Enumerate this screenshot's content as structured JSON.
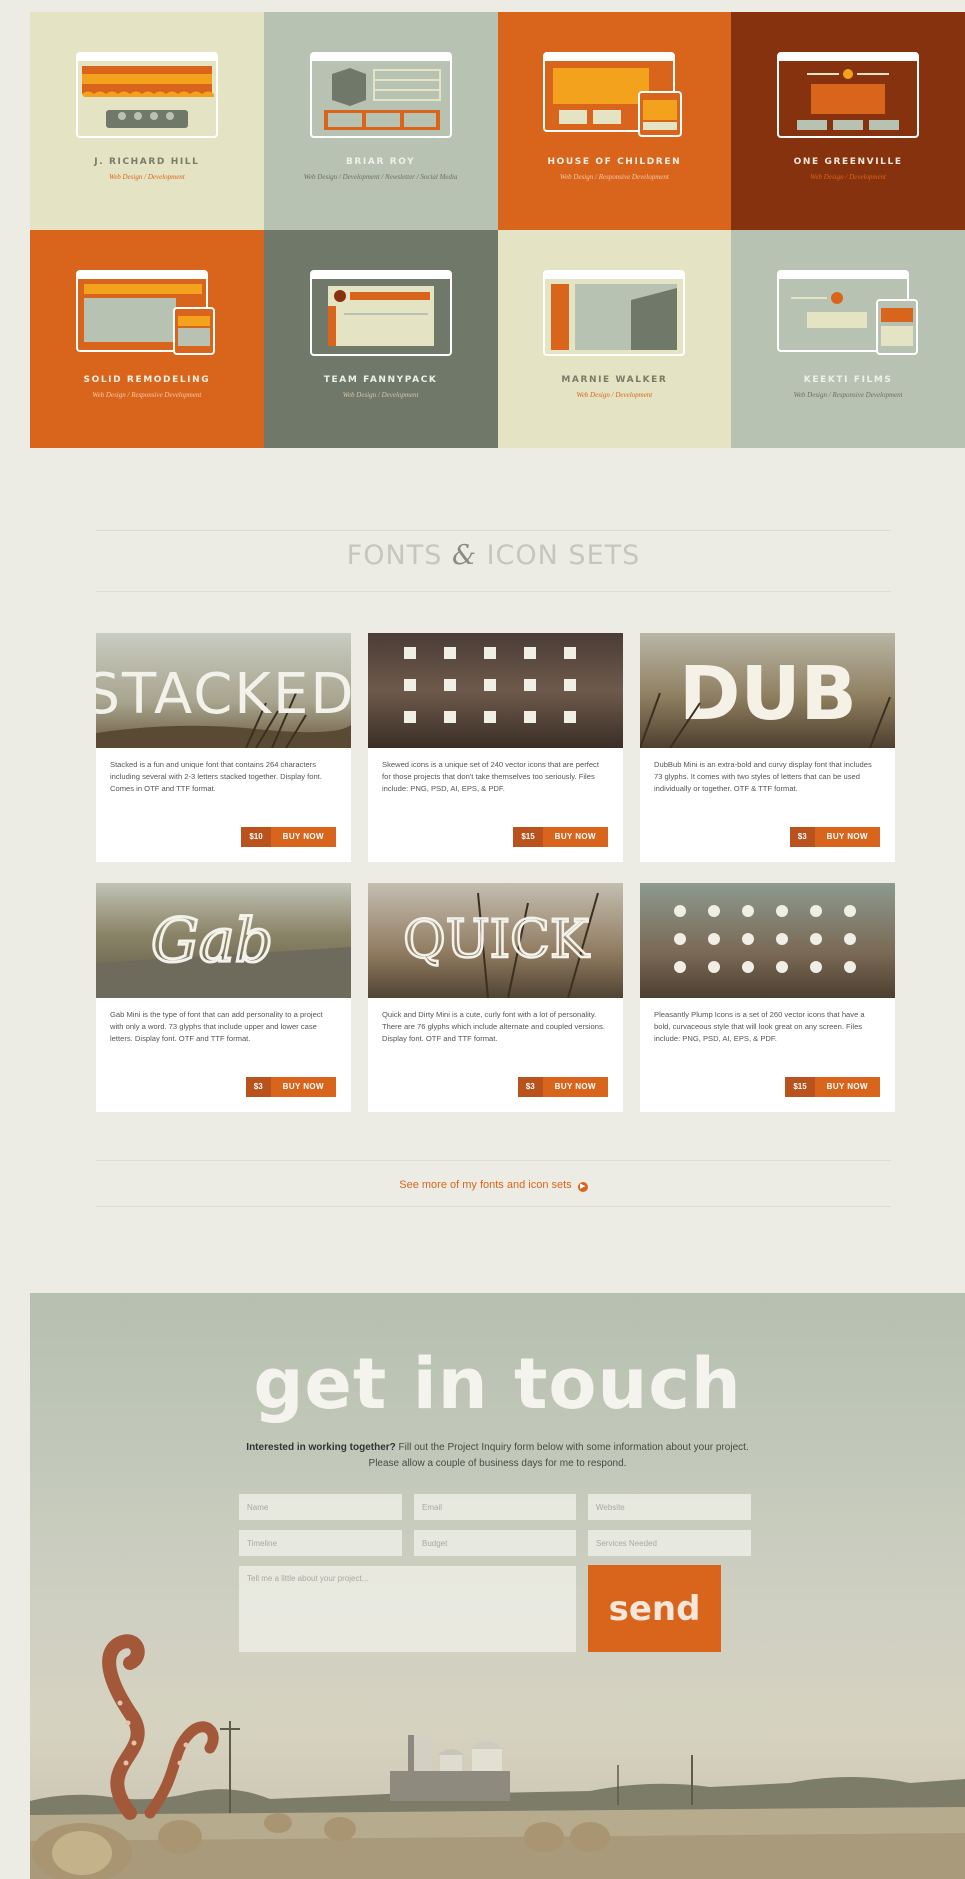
{
  "portfolio": [
    {
      "title": "J. RICHARD HILL",
      "sub": "Web Design / Development",
      "bg": "#e4e3c3",
      "title_color": "#7a7a68",
      "sub_color": "#d9651d"
    },
    {
      "title": "BRIAR ROY",
      "sub": "Web Design / Development / Newsletter / Social Media",
      "bg": "#b8c2b3",
      "title_color": "#eef0ea",
      "sub_color": "#6b6f66"
    },
    {
      "title": "HOUSE OF CHILDREN",
      "sub": "Web Design / Responsive Development",
      "bg": "#d9651d",
      "title_color": "#fbefe4",
      "sub_color": "#f6c9a6"
    },
    {
      "title": "ONE GREENVILLE",
      "sub": "Web Design / Development",
      "bg": "#87320f",
      "title_color": "#f4e8dc",
      "sub_color": "#d9651d"
    },
    {
      "title": "SOLID REMODELING",
      "sub": "Web Design / Responsive Development",
      "bg": "#d9651d",
      "title_color": "#fbefe4",
      "sub_color": "#f6c9a6"
    },
    {
      "title": "TEAM FANNYPACK",
      "sub": "Web Design / Development",
      "bg": "#707869",
      "title_color": "#eef0ea",
      "sub_color": "#d9c6a4"
    },
    {
      "title": "MARNIE WALKER",
      "sub": "Web Design / Development",
      "bg": "#e4e3c3",
      "title_color": "#7a7a68",
      "sub_color": "#d9651d"
    },
    {
      "title": "KEEKTI FILMS",
      "sub": "Web Design / Responsive Development",
      "bg": "#b8c2b3",
      "title_color": "#eef0ea",
      "sub_color": "#6b6f66"
    }
  ],
  "section": {
    "title_left": "FONTS",
    "title_amp": "&",
    "title_right": "ICON SETS"
  },
  "products": [
    {
      "name": "Stacked",
      "desc": "Stacked is a fun and unique font that contains 264 characters including several with 2-3 letters stacked together. Display font. Comes in OTF and TTF format.",
      "price": "$10",
      "buy": "BUY NOW"
    },
    {
      "name": "Skewed icons",
      "desc": "Skewed icons is a unique set of 240 vector icons that are perfect for those projects that don't take themselves too seriously. Files include: PNG, PSD, AI, EPS, & PDF.",
      "price": "$15",
      "buy": "BUY NOW"
    },
    {
      "name": "DUB",
      "desc": "DubBub Mini is an extra-bold and curvy display font that includes 73 glyphs. It comes with two styles of letters that can be used individually or together. OTF & TTF format.",
      "price": "$3",
      "buy": "BUY NOW"
    },
    {
      "name": "Gab",
      "desc": "Gab Mini is the type of font that can add personality to a project with only a word. 73 glyphs that include upper and lower case letters. Display font. OTF and TTF format.",
      "price": "$3",
      "buy": "BUY NOW"
    },
    {
      "name": "QUICK",
      "desc": "Quick and Dirty Mini is a cute, curly font with a lot of personality. There are 76 glyphs which include alternate and coupled versions. Display font. OTF and TTF format.",
      "price": "$3",
      "buy": "BUY NOW"
    },
    {
      "name": "Pleasantly Plump icons",
      "desc": "Pleasantly Plump Icons is a set of 260 vector icons that have a bold, curvaceous style that will look great on any screen. Files include: PNG, PSD, AI, EPS, & PDF.",
      "price": "$15",
      "buy": "BUY NOW"
    }
  ],
  "more_link": "See more of my fonts and icon sets",
  "contact": {
    "title": "get in touch",
    "intro_bold": "Interested in working together?",
    "intro_rest": " Fill out the Project Inquiry form below with some information about your project. Please allow a couple of business days for me to respond.",
    "fields": {
      "name": "Name",
      "email": "Email",
      "website": "Website",
      "timeline": "Timeline",
      "budget": "Budget",
      "services": "Services Needed",
      "message": "Tell me a little about your project..."
    },
    "send": "send"
  },
  "colors": {
    "accent": "#d9651d",
    "accent_dark": "#b9521c",
    "page_bg": "#edece4"
  }
}
